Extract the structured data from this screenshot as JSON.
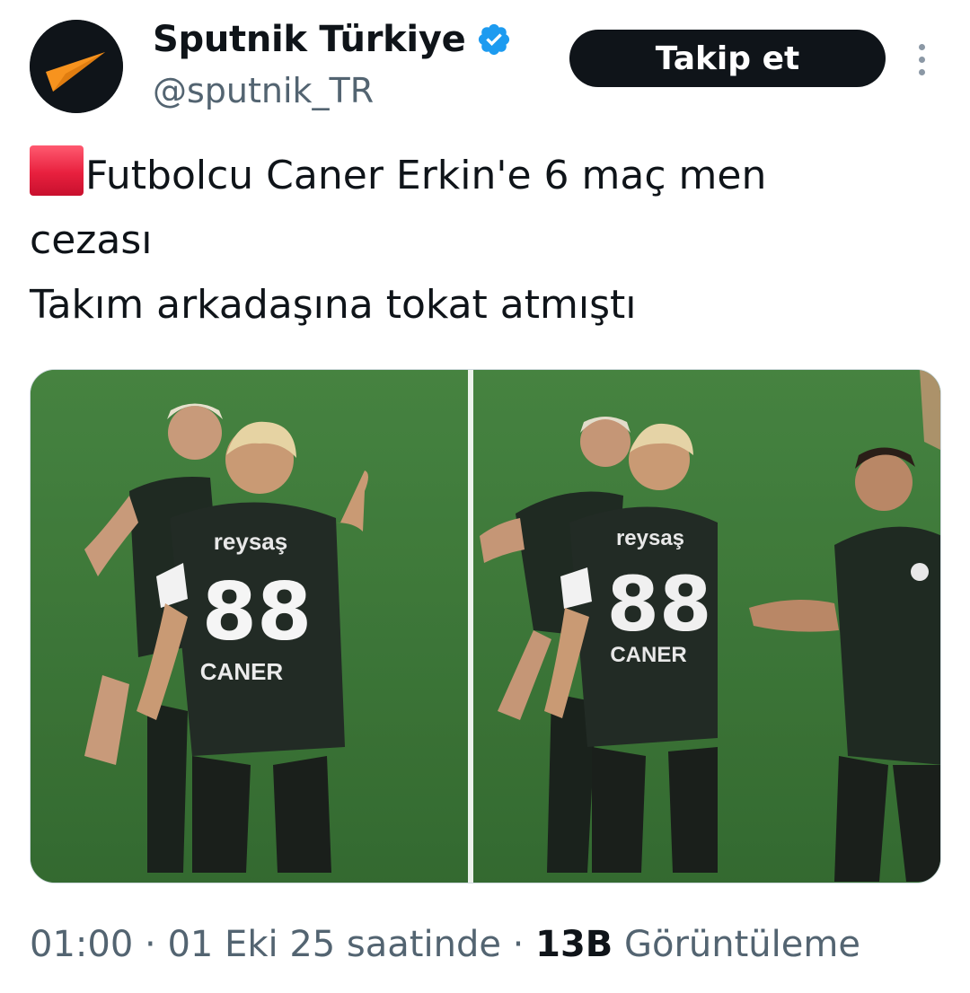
{
  "account": {
    "display_name": "Sputnik Türkiye",
    "handle": "@sputnik_TR",
    "verified": true,
    "avatar_icon": "sputnik-logo-icon",
    "verified_icon": "verified-badge-icon"
  },
  "actions": {
    "follow_label": "Takip et",
    "more_icon": "more-options-icon"
  },
  "tweet": {
    "emoji": "red-square-icon",
    "line1": "Futbolcu Caner Erkin'e 6 maç men",
    "line2": "cezası",
    "line3": "Takım arkadaşına tokat atmıştı"
  },
  "media": {
    "jersey_sponsor": "reysaş",
    "jersey_number": "88",
    "jersey_name_left": "CANER",
    "jersey_name_right": "CANER"
  },
  "meta": {
    "time": "01:00",
    "separator": "·",
    "date": "01 Eki 25 saatinde",
    "view_count": "13B",
    "view_label": "Görüntüleme"
  },
  "colors": {
    "brand_orange": "#f7931e",
    "verified_blue": "#1d9bf0",
    "follow_bg": "#0f1419",
    "secondary_text": "#536471",
    "pitch_green": "#3e7a3a"
  }
}
